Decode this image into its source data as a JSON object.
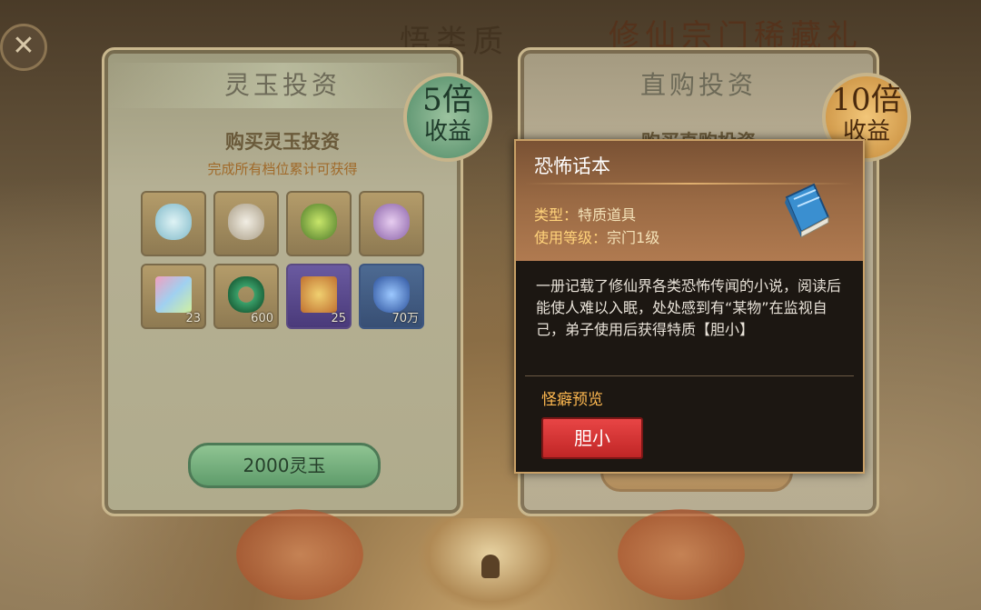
{
  "header": {
    "left_title": "悟类质",
    "right_title": "修仙宗门稀藏礼"
  },
  "left_panel": {
    "title": "灵玉投资",
    "badge_number": "5倍",
    "badge_label": "收益",
    "purchase_title": "购买灵玉投资",
    "subtitle": "完成所有档位累计可获得",
    "items": [
      {
        "icon": "cloud-jade-icon",
        "qty": ""
      },
      {
        "icon": "wrapped-bundle-icon",
        "qty": ""
      },
      {
        "icon": "green-herb-icon",
        "qty": ""
      },
      {
        "icon": "purple-pouch-icon",
        "qty": ""
      },
      {
        "icon": "crystal-shard-icon",
        "qty": "23"
      },
      {
        "icon": "green-jade-ring-icon",
        "qty": "600"
      },
      {
        "icon": "talisman-cards-icon",
        "qty": "25"
      },
      {
        "icon": "blue-spirit-stone-icon",
        "qty": "70万"
      }
    ],
    "buy_button": "2000灵玉"
  },
  "right_panel": {
    "title": "直购投资",
    "badge_number": "10倍",
    "badge_label": "收益",
    "purchase_title": "购买直购投资"
  },
  "popup": {
    "title": "恐怖话本",
    "type_label": "类型：",
    "type_value": "特质道具",
    "level_label": "使用等级：",
    "level_value": "宗门1级",
    "icon": "blue-book-icon",
    "description": "一册记载了修仙界各类恐怖传闻的小说，阅读后能使人难以入眠，处处感到有“某物”在监视自己，弟子使用后获得特质【胆小】",
    "section_title": "怪癖预览",
    "trait_button": "胆小"
  },
  "colors": {
    "accent_red": "#d93434",
    "gold": "#ffb950",
    "popup_bg": "#1c1712"
  }
}
